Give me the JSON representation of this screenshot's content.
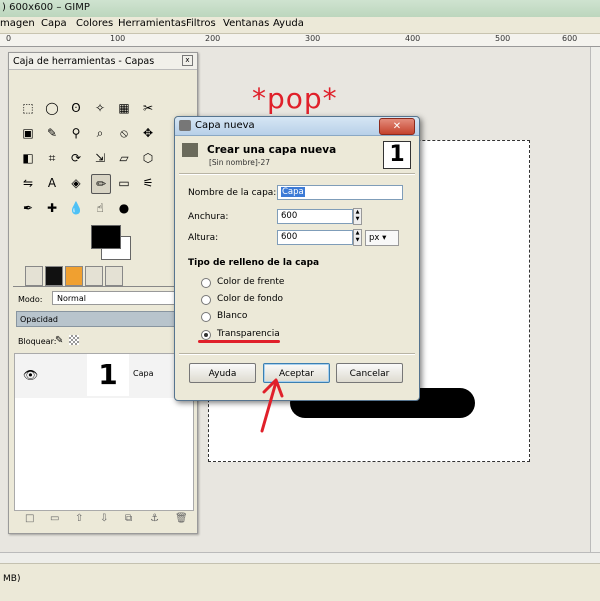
{
  "window": {
    "title": ") 600x600 – GIMP"
  },
  "menubar": {
    "items": [
      "magen",
      "Capa",
      "Colores",
      "Herramientas",
      "Filtros",
      "Ventanas",
      "Ayuda"
    ]
  },
  "ruler": {
    "ticks": [
      "0",
      "100",
      "200",
      "300",
      "400",
      "500",
      "600"
    ]
  },
  "toolbox": {
    "title": "Caja de herramientas - Capas",
    "close": "x",
    "layers": {
      "mode_label": "Modo:",
      "mode_value": "Normal",
      "opacity_label": "Opacidad",
      "opacity_value": "100",
      "lock_label": "Bloquear:",
      "layer_name": "Capa",
      "layer_thumb": "1"
    }
  },
  "status": {
    "text": "MB)"
  },
  "annotation": {
    "text": "*pop*",
    "color": "#e0202a"
  },
  "dialog": {
    "title": "Capa nueva",
    "header_title": "Crear una capa nueva",
    "header_subtitle": "[Sin nombre]-27",
    "header_number": "1",
    "name_label": "Nombre de la capa:",
    "name_value": "Capa",
    "width_label": "Anchura:",
    "width_value": "600",
    "height_label": "Altura:",
    "height_value": "600",
    "unit": "px",
    "fill_heading": "Tipo de relleno de la capa",
    "fill_options": [
      "Color de frente",
      "Color de fondo",
      "Blanco",
      "Transparencia"
    ],
    "fill_selected": "Transparencia",
    "buttons": {
      "help": "Ayuda",
      "ok": "Aceptar",
      "cancel": "Cancelar"
    }
  }
}
